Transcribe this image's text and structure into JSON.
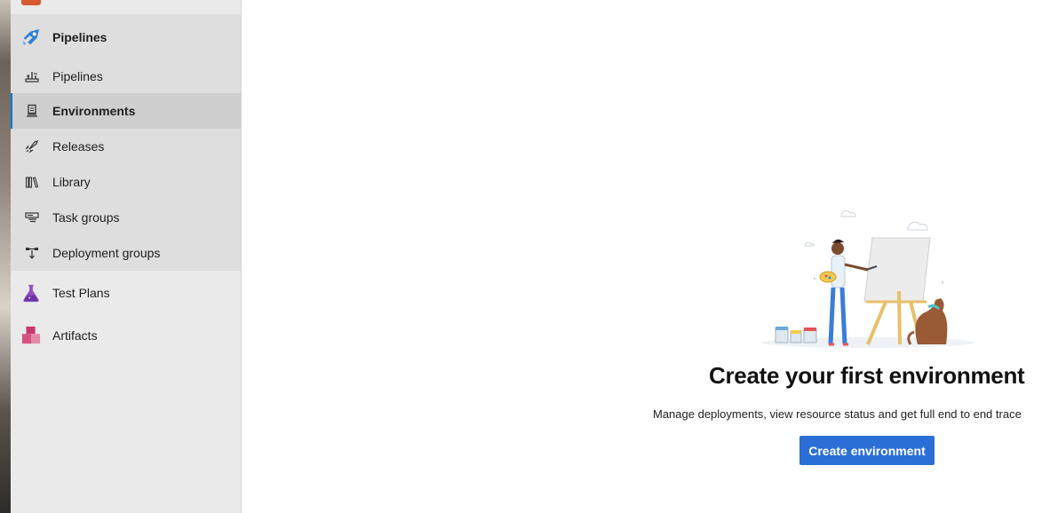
{
  "sidebar": {
    "section_title": "Pipelines",
    "items": [
      {
        "label": "Pipelines",
        "icon": "pipelines-icon"
      },
      {
        "label": "Environments",
        "icon": "environments-icon",
        "selected": true
      },
      {
        "label": "Releases",
        "icon": "rocket-icon"
      },
      {
        "label": "Library",
        "icon": "library-icon"
      },
      {
        "label": "Task groups",
        "icon": "task-groups-icon"
      },
      {
        "label": "Deployment groups",
        "icon": "deployment-groups-icon"
      }
    ],
    "hubs": [
      {
        "label": "Test Plans",
        "icon": "flask-icon"
      },
      {
        "label": "Artifacts",
        "icon": "artifacts-icon"
      }
    ]
  },
  "main": {
    "title": "Create your first environment",
    "description": "Manage deployments, view resource status and get full end to end trace",
    "button_label": "Create environment"
  },
  "colors": {
    "accent": "#0078d4",
    "button": "#2b6fd6",
    "sidebar_bg": "#eaeaea",
    "group_bg": "#dedede",
    "selected_bg": "#cfcfcf"
  }
}
